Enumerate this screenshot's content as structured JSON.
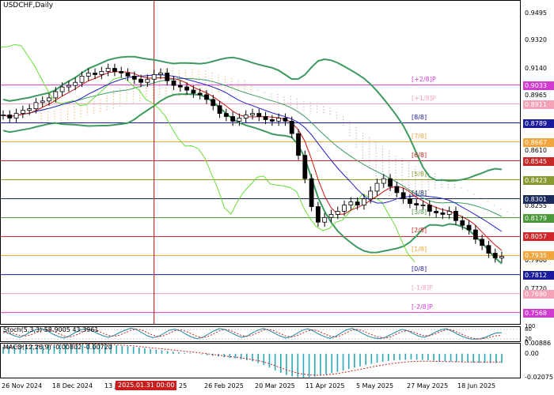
{
  "chart": {
    "symbol_title": "USDCHF,Daily",
    "colors": {
      "candle": "#000000",
      "bollinger": "#3c9a5f",
      "chikou": "#66dd33",
      "kijun": "#2020cc",
      "tenkan": "#cc1111",
      "kumo": "#e8b87a",
      "kumo_alt": "#c8a8d8",
      "cursor": "#a01010"
    },
    "price_axis": {
      "min": 0.749,
      "max": 0.958,
      "ticks": [
        "0.9495",
        "0.9320",
        "0.9140",
        "0.8965",
        "0.8610",
        "0.8255",
        "0.7900",
        "0.7720",
        "0.7545"
      ]
    },
    "murrey_levels": [
      {
        "label": "[+2/8]P",
        "price": 0.9033,
        "value": "0.9033",
        "color": "#d23bd2"
      },
      {
        "label": "[+1/8]P",
        "price": 0.8911,
        "value": "0.8911",
        "color": "#f4a3b6"
      },
      {
        "label": "[8/8]",
        "price": 0.8789,
        "value": "0.8789",
        "color": "#1a1aa0"
      },
      {
        "label": "[7/8]",
        "price": 0.8667,
        "value": "0.8667",
        "color": "#f0a63c"
      },
      {
        "label": "[6/8]",
        "price": 0.8545,
        "value": "0.8545",
        "color": "#c82828"
      },
      {
        "label": "[5/8]",
        "price": 0.8423,
        "value": "0.8423",
        "color": "#8a9a2e"
      },
      {
        "label": "[4/8]",
        "price": 0.8301,
        "value": "0.8301",
        "color": "#1a2a5a"
      },
      {
        "label": "[3/8]",
        "price": 0.8179,
        "value": "0.8179",
        "color": "#4a9a3c"
      },
      {
        "label": "[2/8]",
        "price": 0.8057,
        "value": "0.8057",
        "color": "#d02828"
      },
      {
        "label": "[1/8]",
        "price": 0.7935,
        "value": "0.7935",
        "color": "#f0a63c"
      },
      {
        "label": "[0/8]",
        "price": 0.7812,
        "value": "0.7812",
        "color": "#1a1aa0"
      },
      {
        "label": "[-1/8]P",
        "price": 0.769,
        "value": "0.7690",
        "color": "#f4a3b6"
      },
      {
        "label": "[-2/8]P",
        "price": 0.7568,
        "value": "0.7568",
        "color": "#d23bd2"
      }
    ],
    "current_price": {
      "value": "0.7935"
    },
    "stoch": {
      "title": "Stoch(5,3,3) 58.9005 43.3961",
      "ticks": [
        "100",
        "80",
        "20",
        "0"
      ],
      "main": [
        70,
        55,
        40,
        30,
        45,
        65,
        80,
        85,
        70,
        50,
        35,
        25,
        40,
        60,
        78,
        85,
        72,
        55,
        40,
        30,
        42,
        60,
        75,
        88,
        80,
        60,
        40,
        28,
        35,
        55,
        75,
        82,
        70,
        50,
        32,
        22,
        30,
        50,
        70,
        85,
        80,
        62,
        44,
        30,
        38,
        58,
        76,
        86,
        74,
        56,
        38,
        26,
        34,
        55,
        74,
        84,
        70,
        50,
        34,
        24,
        36,
        58,
        78,
        86,
        72,
        52,
        36,
        26,
        22,
        30,
        48,
        66,
        80,
        72,
        54,
        38,
        30,
        44,
        62,
        78,
        84,
        70,
        50,
        34,
        22,
        18,
        20,
        30,
        45,
        58,
        59
      ],
      "signal": [
        60,
        60,
        52,
        42,
        38,
        46,
        60,
        74,
        78,
        70,
        54,
        38,
        32,
        42,
        58,
        74,
        80,
        72,
        56,
        42,
        36,
        44,
        58,
        74,
        82,
        76,
        60,
        44,
        34,
        40,
        56,
        72,
        78,
        68,
        52,
        36,
        28,
        36,
        52,
        70,
        80,
        74,
        58,
        42,
        36,
        44,
        60,
        76,
        80,
        70,
        54,
        38,
        32,
        40,
        56,
        72,
        78,
        68,
        52,
        38,
        32,
        42,
        60,
        76,
        80,
        70,
        54,
        40,
        30,
        26,
        34,
        50,
        66,
        72,
        64,
        50,
        40,
        40,
        52,
        68,
        78,
        76,
        62,
        46,
        32,
        24,
        20,
        24,
        32,
        40,
        43
      ]
    },
    "macd": {
      "title": "MACD(12,26,9) -0.00802 -0.00720",
      "ticks": [
        "0.00886",
        "0.00",
        "-0.02075"
      ],
      "min": -0.0215,
      "max": 0.0095,
      "hist": [
        0.006,
        0.0065,
        0.007,
        0.0072,
        0.0074,
        0.0075,
        0.0076,
        0.0078,
        0.008,
        0.0081,
        0.0082,
        0.0083,
        0.0084,
        0.0085,
        0.0086,
        0.0086,
        0.0085,
        0.0083,
        0.008,
        0.0077,
        0.0074,
        0.007,
        0.0066,
        0.006,
        0.0054,
        0.0048,
        0.0042,
        0.0036,
        0.003,
        0.0024,
        0.0018,
        0.0012,
        0.0008,
        0.0004,
        0.0,
        -0.0006,
        -0.0012,
        -0.0018,
        -0.0024,
        -0.003,
        -0.0036,
        -0.0042,
        -0.0048,
        -0.0056,
        -0.0066,
        -0.008,
        -0.0098,
        -0.012,
        -0.0145,
        -0.0168,
        -0.0185,
        -0.0198,
        -0.0205,
        -0.0207,
        -0.0205,
        -0.02,
        -0.0192,
        -0.0182,
        -0.017,
        -0.0158,
        -0.0146,
        -0.0134,
        -0.0122,
        -0.011,
        -0.0098,
        -0.0088,
        -0.0078,
        -0.007,
        -0.0063,
        -0.0058,
        -0.0054,
        -0.0052,
        -0.0051,
        -0.0052,
        -0.0054,
        -0.0057,
        -0.006,
        -0.0063,
        -0.0066,
        -0.0069,
        -0.0072,
        -0.0075,
        -0.0077,
        -0.0079,
        -0.008,
        -0.0081,
        -0.0081,
        -0.008,
        -0.008
      ],
      "signal": [
        0.005,
        0.0055,
        0.006,
        0.0064,
        0.0068,
        0.0071,
        0.0073,
        0.0075,
        0.0077,
        0.0079,
        0.008,
        0.0081,
        0.0082,
        0.0083,
        0.0084,
        0.0085,
        0.0085,
        0.0084,
        0.0083,
        0.0081,
        0.0079,
        0.0076,
        0.0072,
        0.0068,
        0.0063,
        0.0058,
        0.0053,
        0.0048,
        0.0043,
        0.0038,
        0.0032,
        0.0027,
        0.0022,
        0.0017,
        0.0012,
        0.0006,
        0.0,
        -0.0006,
        -0.0012,
        -0.0018,
        -0.0024,
        -0.003,
        -0.0036,
        -0.0043,
        -0.0051,
        -0.006,
        -0.0072,
        -0.0087,
        -0.0104,
        -0.0122,
        -0.014,
        -0.0156,
        -0.0169,
        -0.0178,
        -0.0184,
        -0.0187,
        -0.0187,
        -0.0184,
        -0.0179,
        -0.0172,
        -0.0164,
        -0.0155,
        -0.0146,
        -0.0136,
        -0.0126,
        -0.0116,
        -0.0107,
        -0.0098,
        -0.009,
        -0.0083,
        -0.0077,
        -0.0072,
        -0.0068,
        -0.0066,
        -0.0065,
        -0.0065,
        -0.0066,
        -0.0067,
        -0.0068,
        -0.0069,
        -0.007,
        -0.0071,
        -0.0071,
        -0.0072,
        -0.0072,
        -0.0072,
        -0.0072,
        -0.0072,
        -0.0072
      ]
    },
    "x_axis": {
      "labels": [
        "26 Nov 2024",
        "18 Dec 2024",
        "13 J",
        "25",
        "26 Feb 2025",
        "20 Mar 2025",
        "11 Apr 2025",
        "5 May 2025",
        "27 May 2025",
        "18 Jun 2025"
      ],
      "cursor_label": "2025.01.31 00:00"
    }
  },
  "chart_data": {
    "type": "candlestick",
    "title": "USDCHF,Daily",
    "ylim": [
      0.749,
      0.958
    ],
    "dates": [
      "2024-11-26",
      "2024-11-28",
      "2024-12-02",
      "2024-12-04",
      "2024-12-06",
      "2024-12-10",
      "2024-12-12",
      "2024-12-16",
      "2024-12-18",
      "2024-12-20",
      "2024-12-24",
      "2024-12-27",
      "2024-12-31",
      "2025-01-03",
      "2025-01-07",
      "2025-01-09",
      "2025-01-13",
      "2025-01-15",
      "2025-01-17",
      "2025-01-21",
      "2025-01-23",
      "2025-01-27",
      "2025-01-29",
      "2025-01-31",
      "2025-02-04",
      "2025-02-06",
      "2025-02-10",
      "2025-02-12",
      "2025-02-14",
      "2025-02-18",
      "2025-02-20",
      "2025-02-24",
      "2025-02-26",
      "2025-02-28",
      "2025-03-04",
      "2025-03-06",
      "2025-03-10",
      "2025-03-12",
      "2025-03-14",
      "2025-03-18",
      "2025-03-20",
      "2025-03-24",
      "2025-03-26",
      "2025-03-28",
      "2025-04-01",
      "2025-04-03",
      "2025-04-07",
      "2025-04-09",
      "2025-04-11",
      "2025-04-15",
      "2025-04-17",
      "2025-04-21",
      "2025-04-23",
      "2025-04-25",
      "2025-04-29",
      "2025-05-01",
      "2025-05-05",
      "2025-05-07",
      "2025-05-09",
      "2025-05-13",
      "2025-05-15",
      "2025-05-19",
      "2025-05-21",
      "2025-05-23",
      "2025-05-27",
      "2025-05-29",
      "2025-06-02",
      "2025-06-04",
      "2025-06-06",
      "2025-06-10",
      "2025-06-12",
      "2025-06-16",
      "2025-06-18",
      "2025-06-20",
      "2025-06-24",
      "2025-06-26",
      "2025-06-30"
    ],
    "close": [
      0.884,
      0.882,
      0.885,
      0.887,
      0.888,
      0.892,
      0.893,
      0.895,
      0.899,
      0.902,
      0.903,
      0.905,
      0.909,
      0.911,
      0.91,
      0.912,
      0.914,
      0.912,
      0.911,
      0.909,
      0.907,
      0.905,
      0.907,
      0.91,
      0.911,
      0.906,
      0.903,
      0.902,
      0.9,
      0.898,
      0.897,
      0.894,
      0.89,
      0.885,
      0.883,
      0.88,
      0.882,
      0.884,
      0.885,
      0.883,
      0.881,
      0.88,
      0.882,
      0.88,
      0.872,
      0.858,
      0.843,
      0.825,
      0.815,
      0.818,
      0.82,
      0.822,
      0.826,
      0.828,
      0.826,
      0.83,
      0.835,
      0.84,
      0.843,
      0.838,
      0.834,
      0.83,
      0.827,
      0.826,
      0.826,
      0.822,
      0.821,
      0.82,
      0.822,
      0.816,
      0.813,
      0.81,
      0.804,
      0.8,
      0.795,
      0.792,
      0.793
    ]
  }
}
